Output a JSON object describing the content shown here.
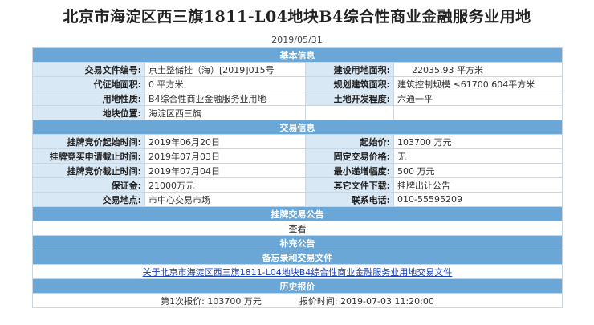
{
  "title": "北京市海淀区西三旗1811-L04地块B4综合性商业金融服务业用地",
  "date": "2019/05/31",
  "sections": {
    "basic": "基本信息",
    "trade": "交易信息",
    "listing_notice": "挂牌交易公告",
    "supplement": "补充公告",
    "memo": "备忘录和交易文件",
    "history": "历史报价"
  },
  "basic": {
    "doc_no_label": "交易文件编号:",
    "doc_no": "京土整储挂（海）[2019]015号",
    "build_area_label": "建设用地面积:",
    "build_area": "22035.93 平方米",
    "proxy_area_label": "代征地面积:",
    "proxy_area": "0 平方米",
    "plan_area_label": "规划建筑面积:",
    "plan_area": "建筑控制规模 ≤61700.604平方米",
    "land_use_label": "用地性质:",
    "land_use": "B4综合性商业金融服务业用地",
    "dev_level_label": "土地开发程度:",
    "dev_level": "六通一平",
    "location_label": "地块位置:",
    "location": "海淀区西三旗"
  },
  "trade": {
    "start_time_label": "挂牌竞价起始时间:",
    "start_time": "2019年06月20日",
    "start_price_label": "起始价:",
    "start_price": "103700 万元",
    "apply_deadline_label": "挂牌竞买申请截止时间:",
    "apply_deadline": "2019年07月03日",
    "fixed_price_label": "固定交易价格:",
    "fixed_price": "无",
    "bid_deadline_label": "挂牌竞价截止时间:",
    "bid_deadline": "2019年07月04日",
    "min_increment_label": "最小递增幅度:",
    "min_increment": "500 万元",
    "deposit_label": "保证金:",
    "deposit": "21000万元",
    "other_docs_label": "其它文件下载:",
    "other_docs": "挂牌出让公告",
    "place_label": "交易地点:",
    "place": "市中心交易市场",
    "phone_label": "联系电话:",
    "phone": "010-55595209"
  },
  "listing_notice_action": "查看",
  "memo_link": "关于北京市海淀区西三旗1811-L04地块B4综合性商业金融服务业用地交易文件",
  "history": {
    "quote": "第1次报价: 103700 万元",
    "quote_time": "报价时间: 2019-07-03 11:20:00"
  },
  "colors": {
    "section_header": "#6aa7d6",
    "label_bg": "#d9e8f5",
    "link": "#1a3fbf"
  }
}
